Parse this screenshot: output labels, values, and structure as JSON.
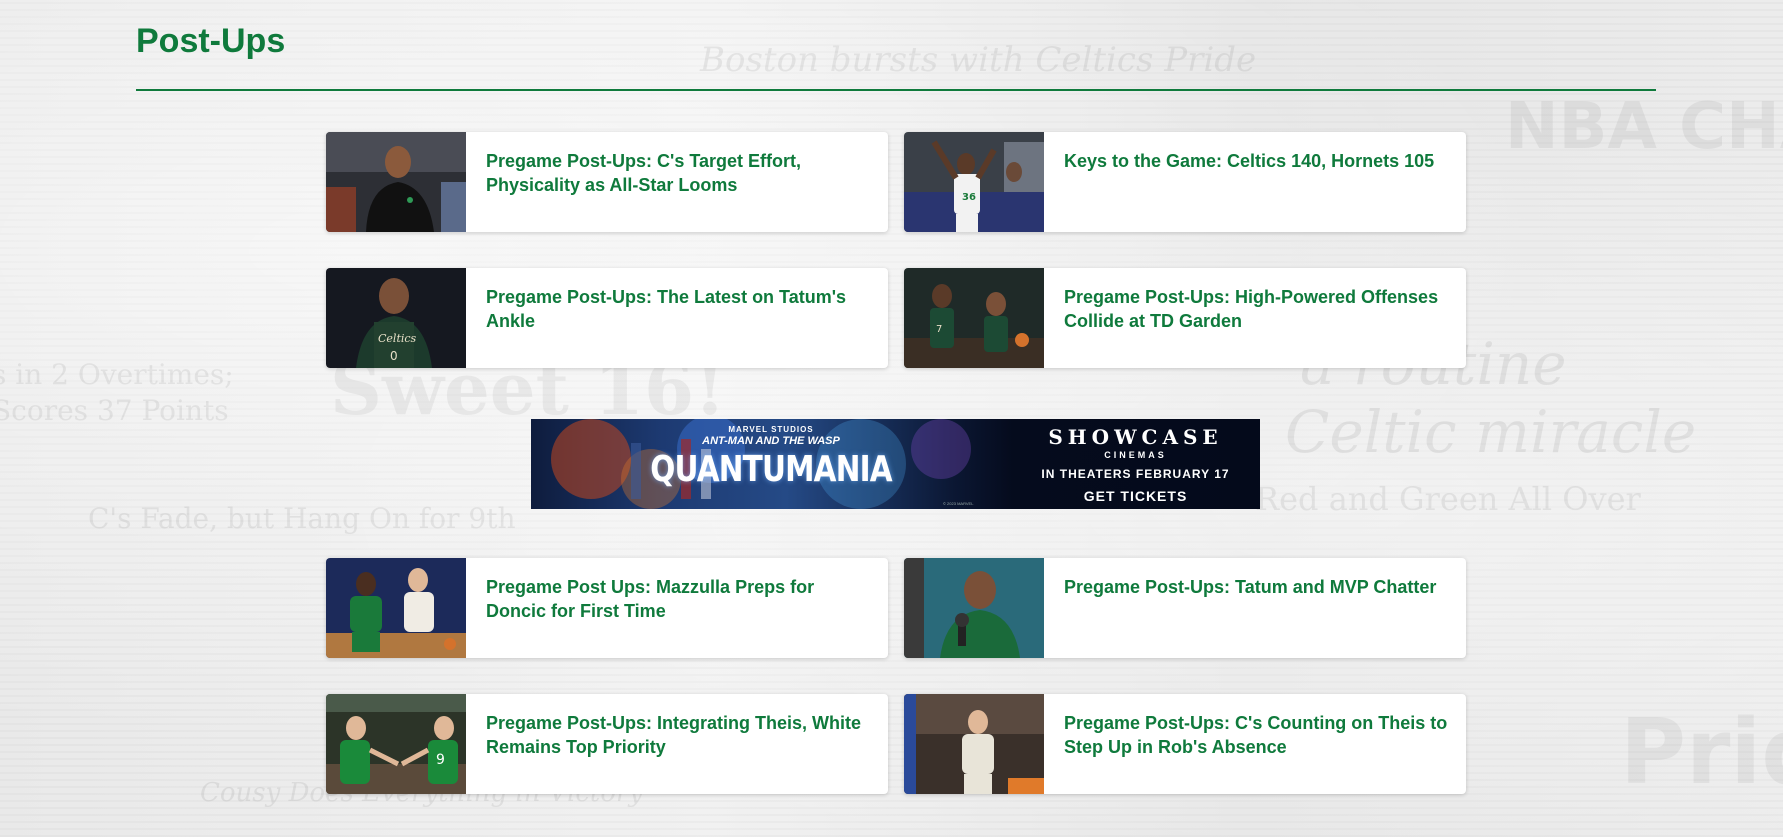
{
  "page": {
    "title": "Post-Ups",
    "accent_color": "#0f7a3c"
  },
  "cards": [
    {
      "title": "Pregame Post-Ups: C's Target Effort, Physicality as All-Star Looms",
      "thumb_icon": "photo-coach-on-sideline"
    },
    {
      "title": "Keys to the Game: Celtics 140, Hornets 105",
      "thumb_icon": "photo-player-celebrating"
    },
    {
      "title": "Pregame Post-Ups: The Latest on Tatum's Ankle",
      "thumb_icon": "photo-tatum-portrait"
    },
    {
      "title": "Pregame Post-Ups: High-Powered Offenses Collide at TD Garden",
      "thumb_icon": "photo-players-dribbling"
    },
    {
      "title": "Pregame Post Ups: Mazzulla Preps for Doncic for First Time",
      "thumb_icon": "photo-defending-doncic"
    },
    {
      "title": "Pregame Post-Ups: Tatum and MVP Chatter",
      "thumb_icon": "photo-tatum-interview"
    },
    {
      "title": "Pregame Post-Ups: Integrating Theis, White Remains Top Priority",
      "thumb_icon": "photo-players-high-five"
    },
    {
      "title": "Pregame Post-Ups: C's Counting on Theis to Step Up in Rob's Absence",
      "thumb_icon": "photo-theis-on-court"
    }
  ],
  "ad": {
    "studio": "MARVEL STUDIOS",
    "subtitle": "ANT-MAN AND THE WASP",
    "movie": "QUANTUMANIA",
    "copyright": "© 2023 MARVEL",
    "brand": "SHOWCASE",
    "brand_sub": "CINEMAS",
    "release": "IN THEATERS FEBRUARY 17",
    "cta": "GET TICKETS"
  },
  "background_text": [
    "Boston bursts with Celtics Pride",
    "Celtic miracle",
    "s in 2 Overtimes;",
    "Scores 37 Points",
    "Sweet 16!",
    "C's Fade, but Hang On for 9th",
    "Red and Green All Over",
    "NBA CHAMPIONS",
    "Cousy Does Everything in Victory",
    "a routine",
    "Pride"
  ]
}
